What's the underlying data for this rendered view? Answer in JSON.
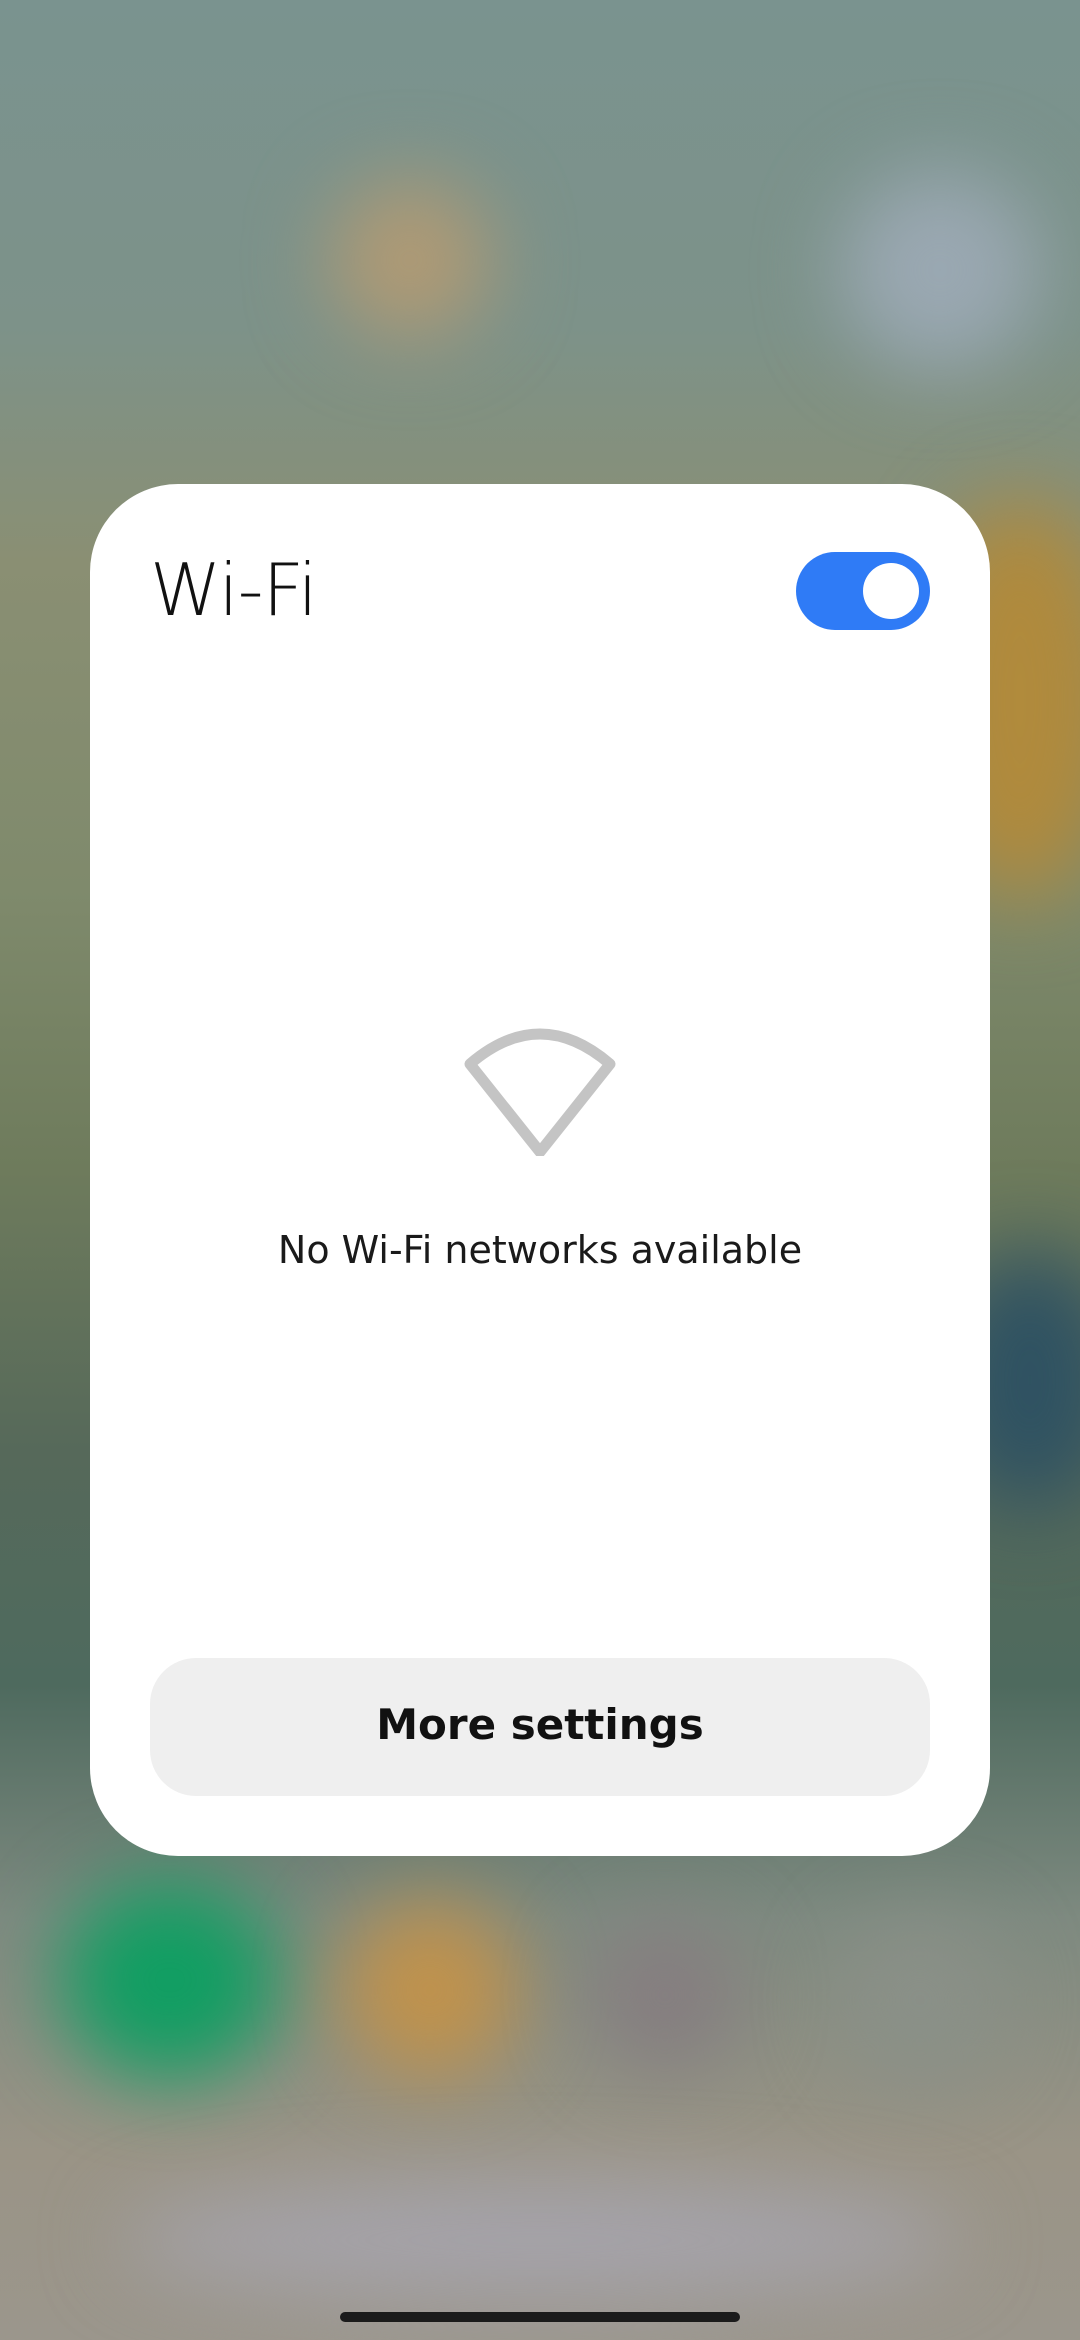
{
  "panel": {
    "title": "Wi-Fi",
    "toggle_state": "on",
    "empty_message": "No Wi-Fi networks available",
    "more_settings_label": "More settings",
    "empty_icon": "wifi-empty-icon"
  },
  "colors": {
    "accent": "#2f7bf6",
    "panel_background": "#ffffff",
    "button_background": "#efefef",
    "icon_gray": "#c4c4c4"
  }
}
